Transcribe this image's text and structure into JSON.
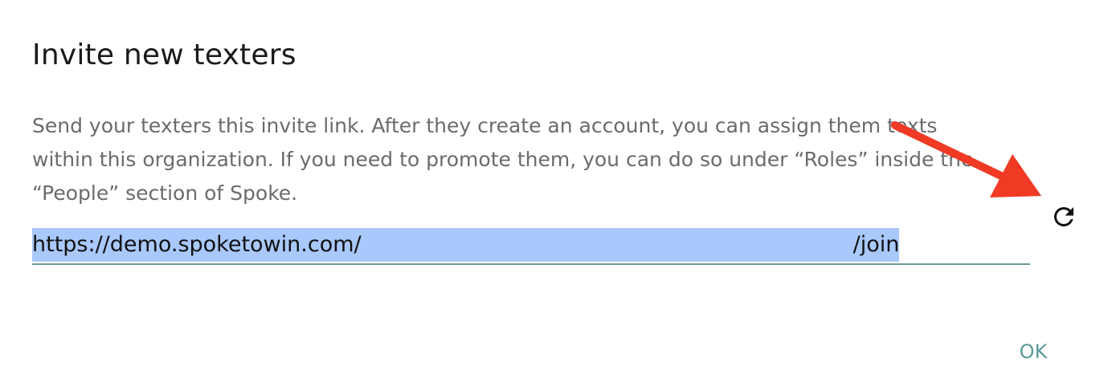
{
  "dialog": {
    "title": "Invite new texters",
    "description": "Send your texters this invite link. After they create an account, you can assign them texts within this organization. If you need to promote them, you can do so under “Roles” inside the “People” section of Spoke.",
    "invite_link": {
      "prefix": "https://demo.spoketowin.com/",
      "suffix": "/join"
    },
    "ok_label": "OK"
  },
  "icons": {
    "refresh": "refresh-icon",
    "annotation_arrow": "arrow-annotation"
  },
  "colors": {
    "accent": "#5a9a9a",
    "selection": "#a9c8fb",
    "annotation": "#f03a24"
  }
}
